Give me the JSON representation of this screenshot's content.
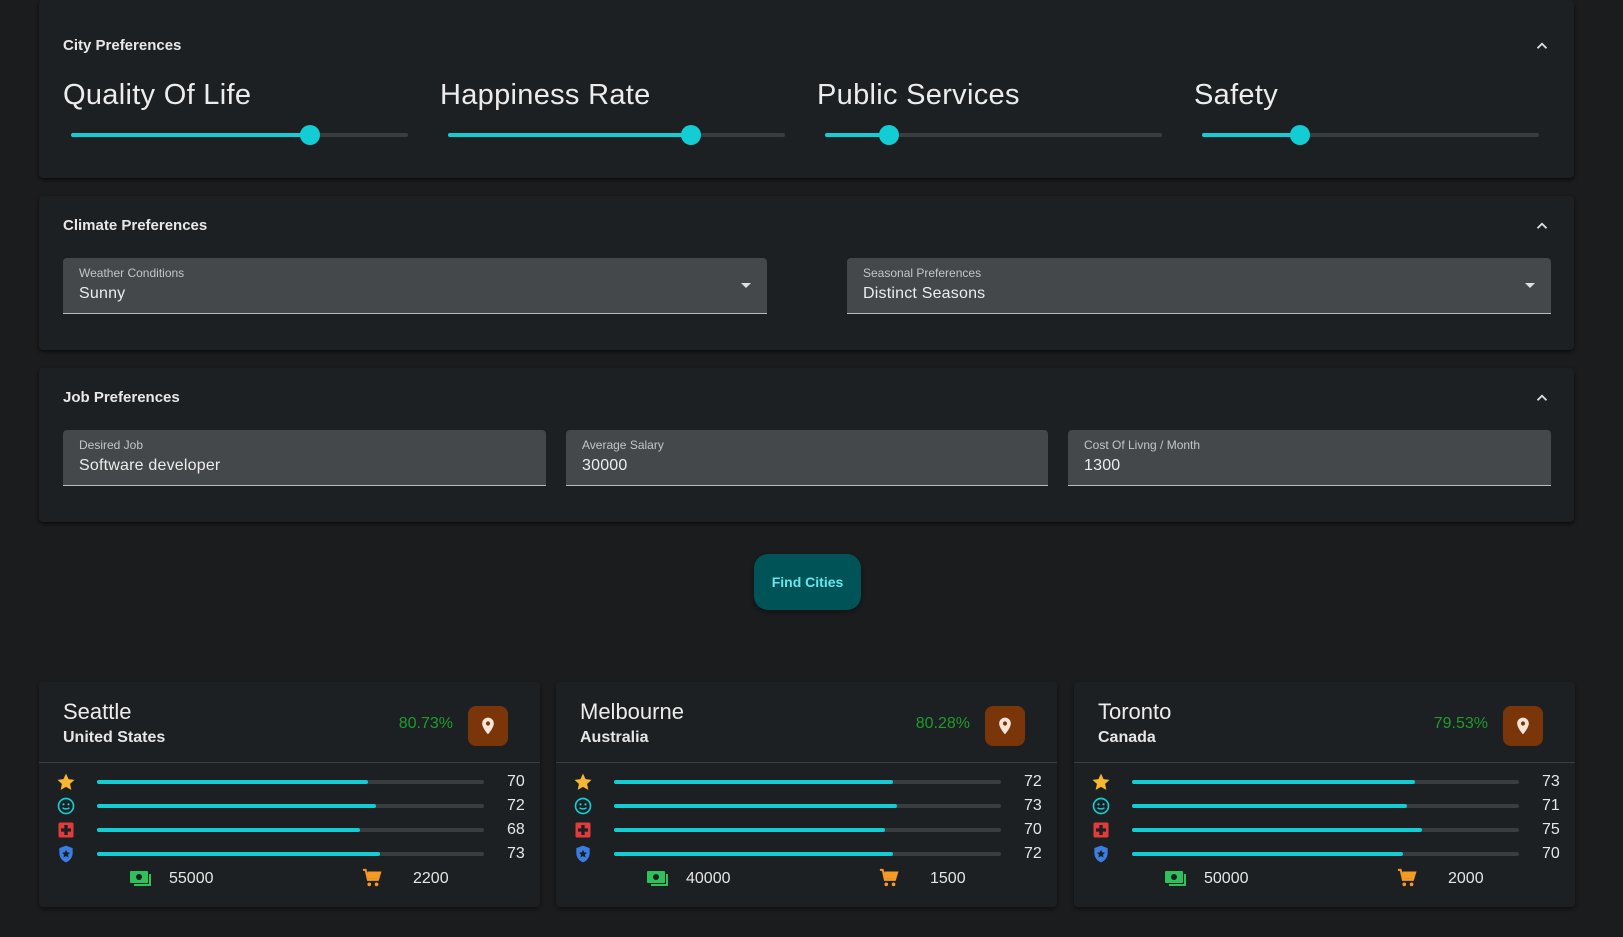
{
  "city_preferences": {
    "title": "City Preferences",
    "sliders": [
      {
        "label": "Quality Of Life",
        "value": 0.71
      },
      {
        "label": "Happiness Rate",
        "value": 0.72
      },
      {
        "label": "Public Services",
        "value": 0.19
      },
      {
        "label": "Safety",
        "value": 0.29
      }
    ]
  },
  "climate_preferences": {
    "title": "Climate Preferences",
    "weather": {
      "label": "Weather Conditions",
      "value": "Sunny"
    },
    "seasonal": {
      "label": "Seasonal Preferences",
      "value": "Distinct Seasons"
    }
  },
  "job_preferences": {
    "title": "Job Preferences",
    "desired_job": {
      "label": "Desired Job",
      "value": "Software developer"
    },
    "average_salary": {
      "label": "Average Salary",
      "value": "30000"
    },
    "cost_of_living": {
      "label": "Cost Of Livng / Month",
      "value": "1300"
    }
  },
  "find_button": "Find Cities",
  "colors": {
    "accent": "#12cdd4",
    "match": "#1e9b2e",
    "star": "#f7b731",
    "happiness": "#12cdd4",
    "health": "#e23b3b",
    "safety": "#3b7de2",
    "money": "#2fc25a",
    "cart": "#f59a23",
    "map_button": "#7a3508"
  },
  "results": [
    {
      "city": "Seattle",
      "country": "United States",
      "match": "80.73%",
      "metrics": {
        "quality": "70",
        "happiness": "72",
        "health": "68",
        "safety": "73"
      },
      "metric_levels": [
        0.7,
        0.72,
        0.68,
        0.73
      ],
      "salary": "55000",
      "cost": "2200"
    },
    {
      "city": "Melbourne",
      "country": "Australia",
      "match": "80.28%",
      "metrics": {
        "quality": "72",
        "happiness": "73",
        "health": "70",
        "safety": "72"
      },
      "metric_levels": [
        0.72,
        0.73,
        0.7,
        0.72
      ],
      "salary": "40000",
      "cost": "1500"
    },
    {
      "city": "Toronto",
      "country": "Canada",
      "match": "79.53%",
      "metrics": {
        "quality": "73",
        "happiness": "71",
        "health": "75",
        "safety": "70"
      },
      "metric_levels": [
        0.73,
        0.71,
        0.75,
        0.7
      ],
      "salary": "50000",
      "cost": "2000"
    }
  ],
  "icons": [
    "chevron-up-icon",
    "dropdown-arrow-icon",
    "map-pin-icon",
    "star-icon",
    "smiley-icon",
    "medical-cross-icon",
    "shield-star-icon",
    "money-icon",
    "cart-icon"
  ]
}
